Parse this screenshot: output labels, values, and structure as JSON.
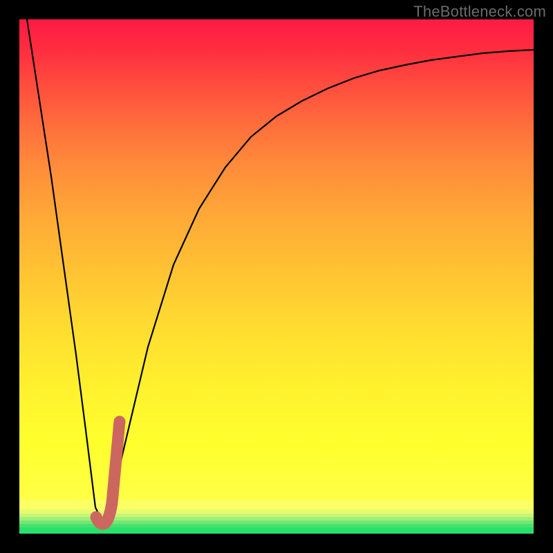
{
  "watermark": "TheBottleneck.com",
  "colors": {
    "frame": "#000000",
    "curve_main": "#000000",
    "curve_accent": "#cc6760",
    "green_strip": "#28e06a"
  },
  "chart_data": {
    "type": "line",
    "title": "",
    "xlabel": "",
    "ylabel": "",
    "xlim": [
      0,
      100
    ],
    "ylim": [
      0,
      100
    ],
    "series": [
      {
        "name": "bottleneck-curve",
        "x": [
          0,
          5,
          10,
          12,
          14,
          16,
          18,
          20,
          25,
          30,
          35,
          40,
          45,
          50,
          55,
          60,
          65,
          70,
          75,
          80,
          85,
          90,
          95,
          100
        ],
        "values": [
          99,
          69,
          35,
          20,
          5,
          2,
          6,
          15,
          36,
          52,
          63,
          71,
          77,
          81,
          84,
          86.5,
          88.5,
          90,
          91,
          92,
          92.7,
          93.3,
          93.7,
          94
        ]
      },
      {
        "name": "accent-segment",
        "x": [
          14.5,
          15,
          16,
          17,
          18,
          18.8
        ],
        "values": [
          3,
          2,
          2,
          7,
          15,
          22
        ]
      }
    ],
    "gradient_stops": [
      {
        "pos": 0.0,
        "color": "#ff1a44"
      },
      {
        "pos": 0.5,
        "color": "#ffb035"
      },
      {
        "pos": 0.88,
        "color": "#ffff2d"
      },
      {
        "pos": 0.955,
        "color": "#f2ff6a"
      },
      {
        "pos": 0.975,
        "color": "#b9f57b"
      },
      {
        "pos": 0.99,
        "color": "#55e572"
      },
      {
        "pos": 1.0,
        "color": "#28e06a"
      }
    ]
  }
}
